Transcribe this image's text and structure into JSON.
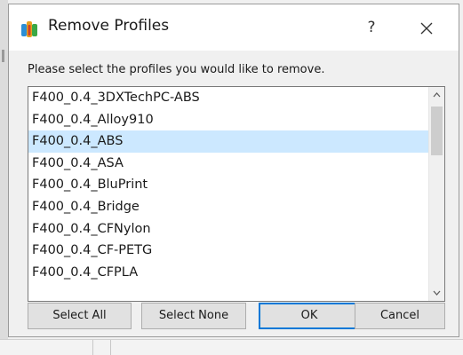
{
  "dialog": {
    "title": "Remove Profiles",
    "help_label": "?",
    "instruction": "Please select the profiles you would like to remove.",
    "icons": {
      "app": "profiles-app-icon",
      "close": "close-icon",
      "scroll_up": "chevron-up-icon",
      "scroll_down": "chevron-down-icon"
    },
    "colors": {
      "selection": "#cce8ff",
      "focus_border": "#0078d7"
    }
  },
  "profiles": {
    "items": [
      "F400_0.4_3DXTechPC-ABS",
      "F400_0.4_Alloy910",
      "F400_0.4_ABS",
      "F400_0.4_ASA",
      "F400_0.4_BluPrint",
      "F400_0.4_Bridge",
      "F400_0.4_CFNylon",
      "F400_0.4_CF-PETG",
      "F400_0.4_CFPLA"
    ],
    "selected": "F400_0.4_ABS"
  },
  "buttons": {
    "select_all": "Select All",
    "select_none": "Select None",
    "ok": "OK",
    "cancel": "Cancel"
  }
}
